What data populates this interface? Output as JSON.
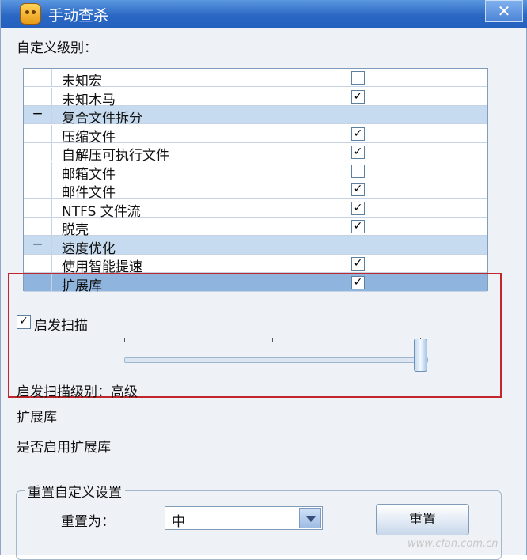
{
  "window": {
    "title": "手动查杀",
    "close_glyph": "✕"
  },
  "custom_level_label": "自定义级别：",
  "list": {
    "rows": [
      {
        "type": "item",
        "label": "未知宏",
        "checked": false
      },
      {
        "type": "item",
        "label": "未知木马",
        "checked": true
      },
      {
        "type": "group",
        "label": "复合文件拆分",
        "toggle": "−"
      },
      {
        "type": "item",
        "label": "压缩文件",
        "checked": true
      },
      {
        "type": "item",
        "label": "自解压可执行文件",
        "checked": true
      },
      {
        "type": "item",
        "label": "邮箱文件",
        "checked": false
      },
      {
        "type": "item",
        "label": "邮件文件",
        "checked": true
      },
      {
        "type": "item",
        "label": "NTFS 文件流",
        "checked": true
      },
      {
        "type": "item",
        "label": "脱壳",
        "checked": true
      },
      {
        "type": "group",
        "label": "速度优化",
        "toggle": "−"
      },
      {
        "type": "item",
        "label": "使用智能提速",
        "checked": true
      },
      {
        "type": "item",
        "label": "扩展库",
        "checked": true,
        "selected": true
      }
    ]
  },
  "heuristic": {
    "label": "启发扫描",
    "checked": true,
    "slider_fraction": 1.0,
    "level_text": "启发扫描级别：高级"
  },
  "description": {
    "title": "扩展库",
    "text": "是否启用扩展库"
  },
  "reset_group": {
    "title": "重置自定义设置",
    "reset_to_label": "重置为：",
    "selected_option": "中",
    "reset_button": "重置"
  },
  "watermark": "www.cfan.com.cn",
  "colors": {
    "titlebar": "#2a67c4",
    "highlight_border": "#c0262c",
    "selected_row": "#8fb4de",
    "group_row": "#c7dbf0"
  },
  "icons": {
    "check": "✓",
    "dropdown": "chevron-down-icon",
    "close": "close-icon"
  }
}
